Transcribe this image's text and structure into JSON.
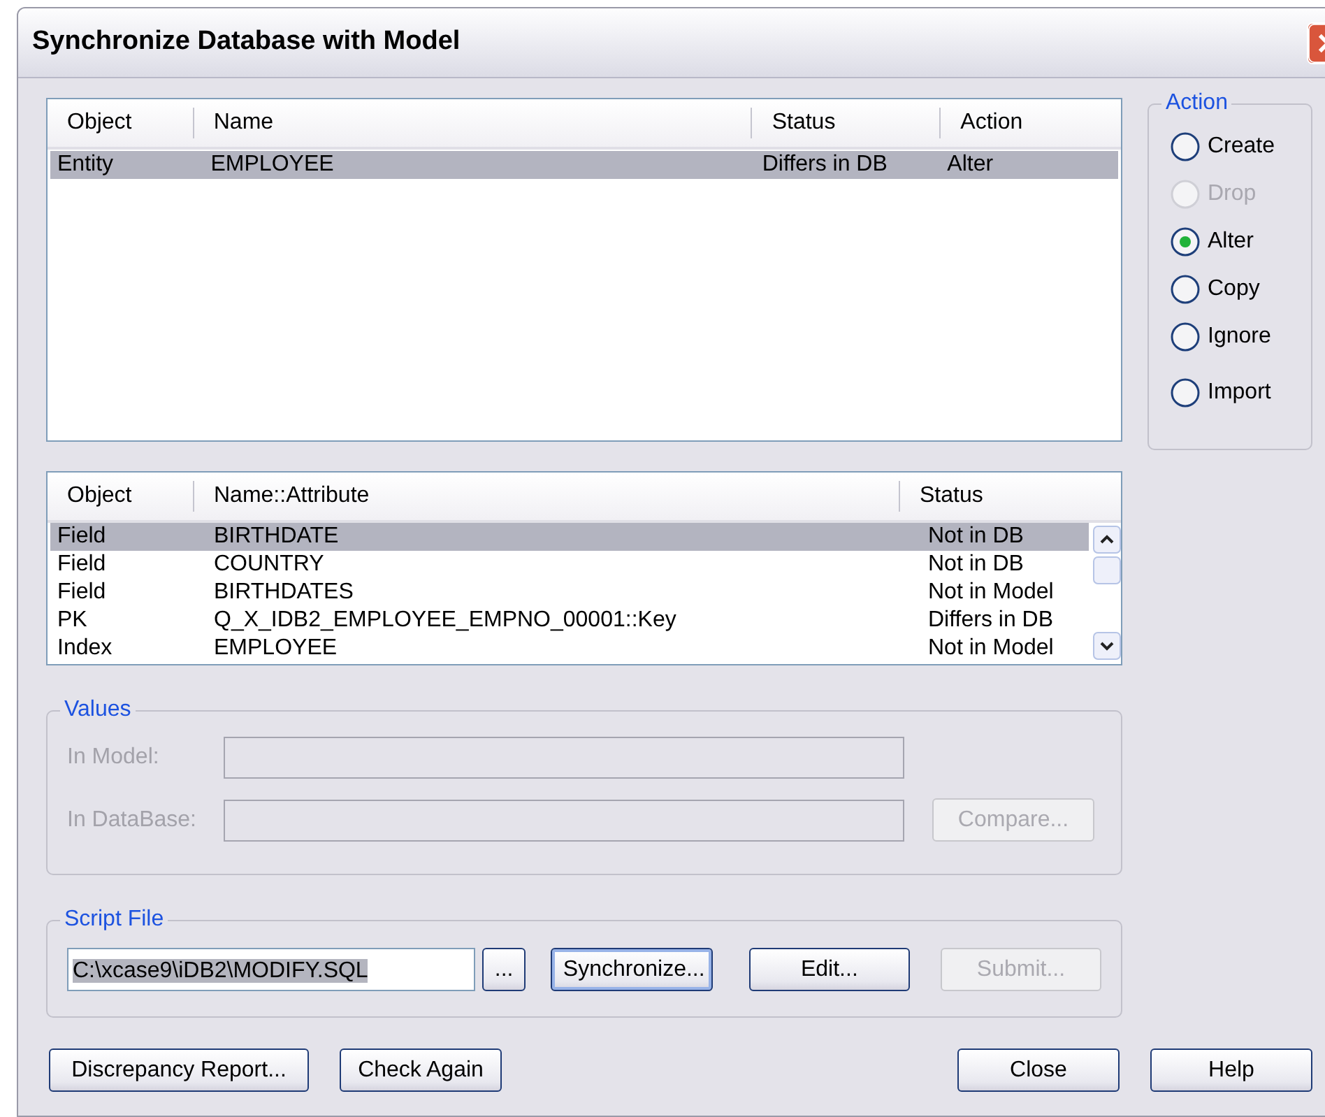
{
  "window": {
    "title": "Synchronize Database with Model"
  },
  "object_list": {
    "columns": [
      "Object",
      "Name",
      "Status",
      "Action"
    ],
    "rows": [
      {
        "object": "Entity",
        "name": "EMPLOYEE",
        "status": "Differs in DB",
        "action": "Alter",
        "selected": true
      }
    ]
  },
  "attribute_list": {
    "columns": [
      "Object",
      "Name::Attribute",
      "Status"
    ],
    "rows": [
      {
        "object": "Field",
        "name": "BIRTHDATE",
        "status": "Not in DB",
        "selected": true
      },
      {
        "object": "Field",
        "name": "COUNTRY",
        "status": "Not in DB",
        "selected": false
      },
      {
        "object": "Field",
        "name": "BIRTHDATES",
        "status": "Not in Model",
        "selected": false
      },
      {
        "object": "PK",
        "name": "Q_X_IDB2_EMPLOYEE_EMPNO_00001::Key",
        "status": "Differs in DB",
        "selected": false
      },
      {
        "object": "Index",
        "name": "EMPLOYEE",
        "status": "Not in Model",
        "selected": false
      }
    ]
  },
  "action_group": {
    "title": "Action",
    "options": [
      {
        "label": "Create",
        "selected": false,
        "disabled": false
      },
      {
        "label": "Drop",
        "selected": false,
        "disabled": true
      },
      {
        "label": "Alter",
        "selected": true,
        "disabled": false
      },
      {
        "label": "Copy",
        "selected": false,
        "disabled": false
      },
      {
        "label": "Ignore",
        "selected": false,
        "disabled": false
      },
      {
        "label": "Import",
        "selected": false,
        "disabled": false
      }
    ]
  },
  "values_group": {
    "title": "Values",
    "disabled": true,
    "fields": [
      {
        "label": "In Model:"
      },
      {
        "label": "In DataBase:"
      }
    ],
    "compare_button": {
      "label": "Compare...",
      "disabled": true
    }
  },
  "script_group": {
    "title": "Script File",
    "path": "C:\\xcase9\\iDB2\\MODIFY.SQL",
    "path_highlighted": true,
    "browse_button": {
      "label": "...",
      "disabled": false
    },
    "buttons": [
      {
        "label": "Synchronize...",
        "disabled": false,
        "focused": true
      },
      {
        "label": "Edit...",
        "disabled": false,
        "focused": false
      },
      {
        "label": "Submit...",
        "disabled": true,
        "focused": false
      }
    ]
  },
  "footer_left": [
    {
      "label": "Discrepancy Report..."
    },
    {
      "label": "Check Again"
    }
  ],
  "footer_right": [
    {
      "label": "Close"
    },
    {
      "label": "Help"
    }
  ]
}
